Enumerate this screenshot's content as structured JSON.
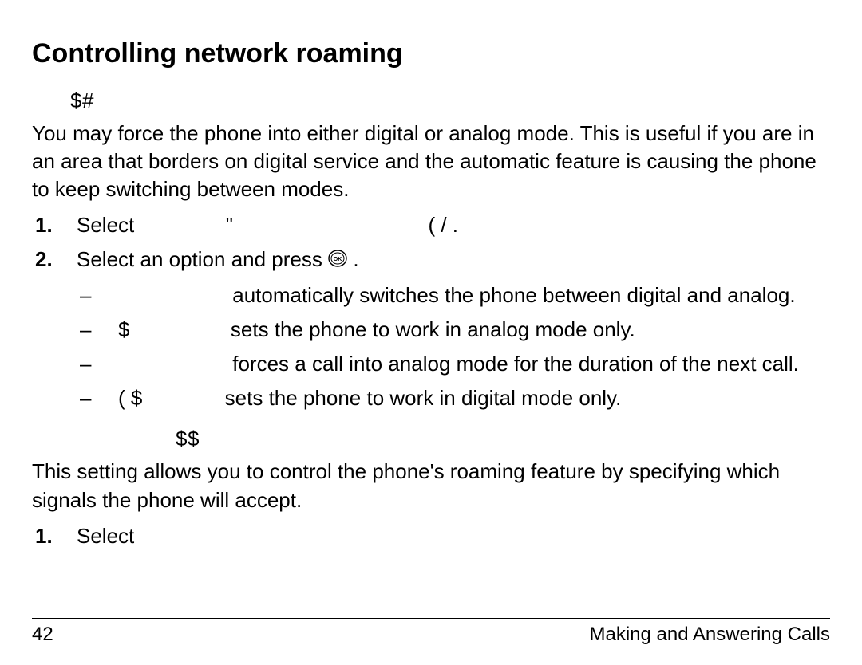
{
  "title": "Controlling network roaming",
  "section1": {
    "subhead": "$#",
    "intro": "You may force the phone into either digital or analog mode. This is useful if you are in an area that borders on digital service and the automatic feature is causing the phone to keep switching between modes.",
    "step1_lead": "Select",
    "step1_mid": "\"",
    "step1_tail": "(     /        .",
    "step2_lead": "Select an option and press",
    "step2_tail": ".",
    "options": [
      {
        "prefix": "",
        "text": "automatically switches the phone between digital and analog."
      },
      {
        "prefix": "$",
        "text": "sets the phone to work in analog mode only."
      },
      {
        "prefix": "",
        "text": "forces a call into analog mode for the duration of the next call."
      },
      {
        "prefix": "(        $",
        "text": "sets the phone to work in digital mode only."
      }
    ]
  },
  "section2": {
    "subhead": "$$",
    "intro": "This setting allows you to control the phone's roaming feature by specifying which signals the phone will accept.",
    "step1": "Select"
  },
  "footer": {
    "page_number": "42",
    "chapter": "Making and Answering Calls"
  }
}
